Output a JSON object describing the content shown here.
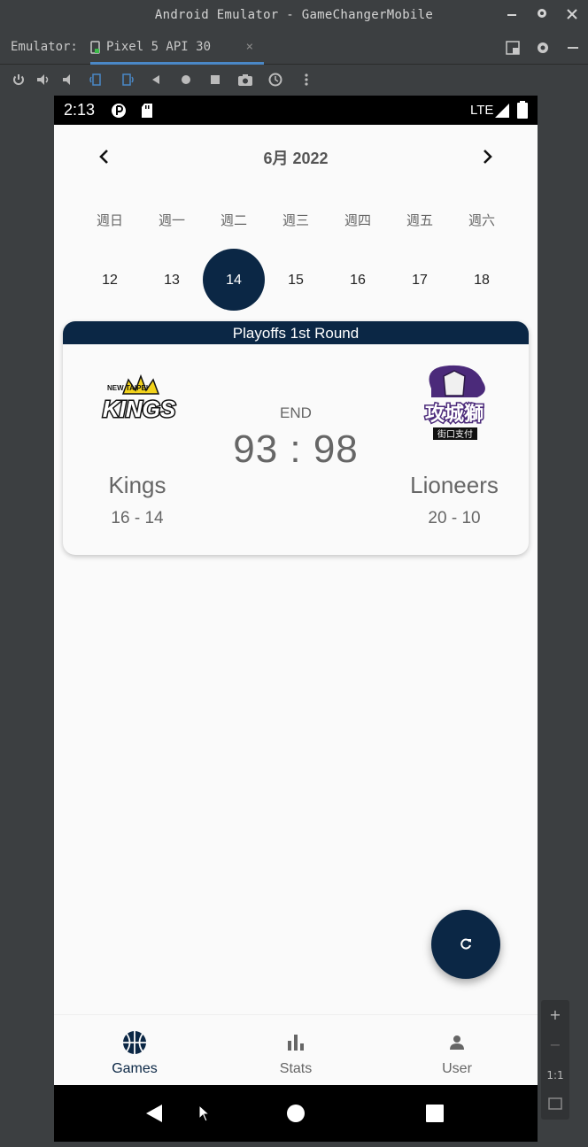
{
  "window": {
    "title": "Android Emulator - GameChangerMobile",
    "minimize_icon": "minimize-icon",
    "settings_icon": "gear-icon",
    "close_icon": "close-icon"
  },
  "emulator_tabs": {
    "label": "Emulator:",
    "active_tab": "Pixel 5 API 30",
    "close_glyph": "×"
  },
  "device_status": {
    "time": "2:13",
    "network": "LTE"
  },
  "calendar": {
    "month_label": "6月 2022",
    "weekdays": [
      "週日",
      "週一",
      "週二",
      "週三",
      "週四",
      "週五",
      "週六"
    ],
    "days": [
      "12",
      "13",
      "14",
      "15",
      "16",
      "17",
      "18"
    ],
    "selected_day": "14"
  },
  "game": {
    "round": "Playoffs 1st Round",
    "state": "END",
    "score": "93 : 98",
    "home": {
      "name": "Kings",
      "record": "16 - 14",
      "logo_text": "KINGS",
      "logo_sub": "NEW TAIPEI"
    },
    "away": {
      "name": "Lioneers",
      "record": "20 - 10",
      "logo_text": "攻城獅",
      "logo_sub": "街口支付"
    }
  },
  "bottom_nav": {
    "items": [
      {
        "label": "Games",
        "icon": "basketball-icon"
      },
      {
        "label": "Stats",
        "icon": "bar-chart-icon"
      },
      {
        "label": "User",
        "icon": "person-icon"
      }
    ]
  },
  "zoom": {
    "plus": "+",
    "minus": "−",
    "one_to_one": "1:1"
  },
  "colors": {
    "primary": "#0b2745",
    "surface": "#fafafa",
    "text_muted": "#666666",
    "emulator_frame": "#3c3f41"
  }
}
